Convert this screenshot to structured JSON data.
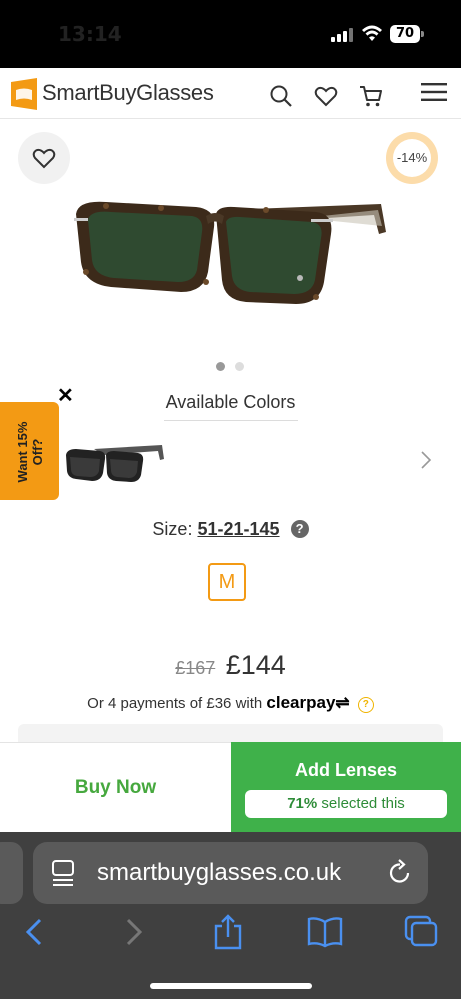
{
  "status_bar": {
    "time": "13:14",
    "battery": "70"
  },
  "header": {
    "brand": "SmartBuyGlasses",
    "icons": [
      "search-icon",
      "heart-icon",
      "cart-icon",
      "menu-icon"
    ],
    "brand_color": "#f39a14"
  },
  "product": {
    "discount": "-14%",
    "image_index": 1,
    "image_count": 2,
    "available_colors_title": "Available Colors",
    "promo": {
      "text": "Want 15% Off?"
    },
    "size_label": "Size:",
    "size_value": "51-21-145",
    "size_code": "M",
    "old_price": "£167",
    "price": "£144",
    "installments_text": "Or 4 payments of £36 with",
    "installments_provider": "clearpay"
  },
  "cta": {
    "buy_now": "Buy Now",
    "add_lenses": "Add Lenses",
    "selected_percent": "71%",
    "selected_text": "selected this",
    "buy_color": "#46a83e",
    "lenses_color": "#3fb14a"
  },
  "browser": {
    "url": "smartbuyglasses.co.uk",
    "toolbar": [
      "back-icon",
      "forward-icon",
      "share-icon",
      "bookmarks-icon",
      "tabs-icon"
    ]
  }
}
